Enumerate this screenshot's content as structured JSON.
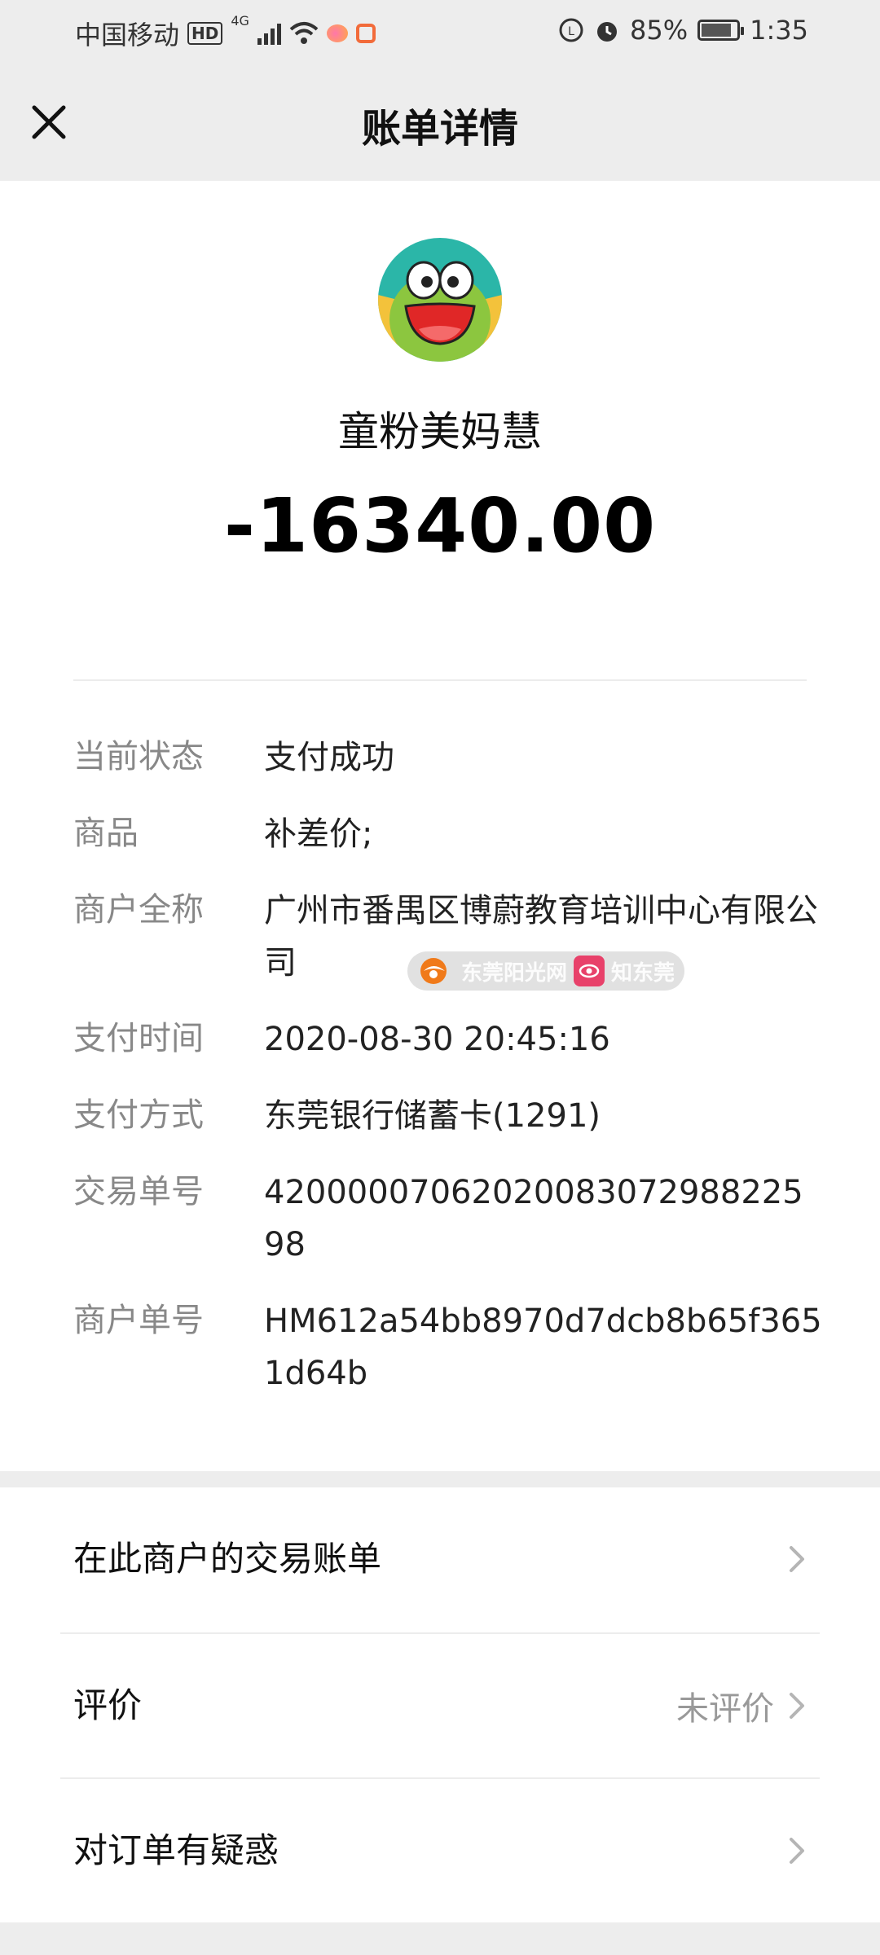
{
  "status_bar": {
    "carrier": "中国移动",
    "hd_badge": "HD",
    "network": "4G",
    "battery_percent": "85%",
    "time": "1:35"
  },
  "header": {
    "title": "账单详情",
    "close_icon": "close-icon"
  },
  "merchant": {
    "name": "童粉美妈慧",
    "amount": "-16340.00"
  },
  "details": [
    {
      "label": "当前状态",
      "value": "支付成功"
    },
    {
      "label": "商品",
      "value": "补差价;"
    },
    {
      "label": "商户全称",
      "value": "广州市番禺区博蔚教育培训中心有限公司"
    },
    {
      "label": "支付时间",
      "value": "2020-08-30 20:45:16"
    },
    {
      "label": "支付方式",
      "value": "东莞银行储蓄卡(1291)"
    },
    {
      "label": "交易单号",
      "value": "42000007062020083072988225 98"
    },
    {
      "label": "商户单号",
      "value": "HM612a54bb8970d7dcb8b65f3651d64b"
    }
  ],
  "watermark": {
    "text1": "东莞阳光网",
    "text2": "知东莞"
  },
  "list": [
    {
      "label": "在此商户的交易账单",
      "sub": ""
    },
    {
      "label": "评价",
      "sub": "未评价"
    },
    {
      "label": "对订单有疑惑",
      "sub": ""
    }
  ],
  "colors": {
    "background": "#ededed",
    "card": "#ffffff",
    "label_gray": "#888888",
    "avatar_teal": "#2bb6a8",
    "avatar_yellow": "#f3c23b",
    "avatar_green": "#8cc63f",
    "avatar_red": "#e02727"
  }
}
